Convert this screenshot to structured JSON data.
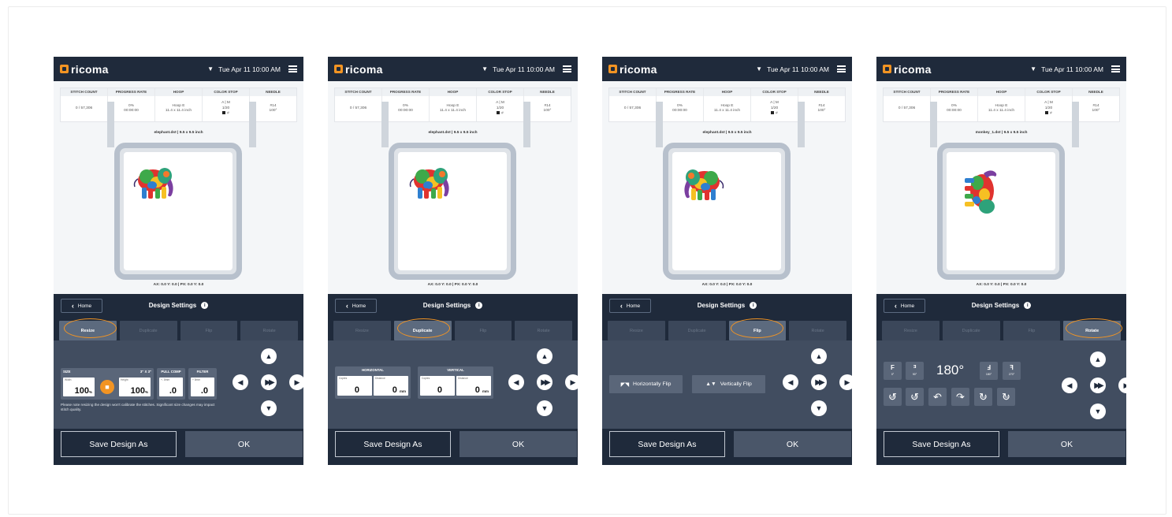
{
  "common": {
    "brand": "ricoma",
    "datetime": "Tue Apr 11  10:00 AM",
    "stat_headers": [
      "STITCH COUNT",
      "PROGRESS RATE",
      "HOOP",
      "COLOR STOP",
      "NEEDLE"
    ],
    "stitch_count": "0 / 57,306",
    "progress_pct": "0%",
    "progress_time": "00:00:00",
    "hoop_name": "Hoop E",
    "hoop_size": "11.4 x 11.4 inch",
    "color_mode": "A | M",
    "color_stop": "1/20",
    "color_num": "#",
    "needle_num": "#14",
    "needle_angle": "100°",
    "coords": "AX: 0.0  Y: 0.0  |  PX: 0.0  Y: 0.0",
    "home_label": "Home",
    "title": "Design Settings",
    "tabs": [
      "Resize",
      "Duplicate",
      "Flip",
      "Rotate"
    ],
    "save_label": "Save Design As",
    "ok_label": "OK"
  },
  "panels": [
    {
      "filename": "elephant.dst  |  9.5 x 9.5 inch",
      "active_tab": "Resize"
    },
    {
      "filename": "elephant.dst  |  9.5 x 9.5 inch",
      "active_tab": "Duplicate"
    },
    {
      "filename": "elephant.dst  |  9.5 x 9.5 inch",
      "active_tab": "Flip"
    },
    {
      "filename": "monkey_1.dst  |  9.5 x 9.5 inch",
      "active_tab": "Rotate"
    }
  ],
  "resize": {
    "size_label": "SIZE",
    "size_value": "3\" X 3\"",
    "width_label": "Width",
    "width_value": "100",
    "height_label": "Height",
    "height_value": "100",
    "unit": "%",
    "pull_comp_label": "PULL COMP",
    "pull_comp_sub": "+- 8mm",
    "pull_comp_value": ".0",
    "filter_label": "FILTER",
    "filter_sub": "+ 8mm",
    "filter_value": ".0",
    "note": "Please note resizing the design won't calibrate the stitches. Significant size changes may impact stitch quality."
  },
  "duplicate": {
    "horizontal_label": "HORIZONTAL",
    "vertical_label": "VERTICAL",
    "copies_label": "Copies",
    "distance_label": "Distance",
    "h_copies": "0",
    "h_distance": "0",
    "v_copies": "0",
    "v_distance": "0",
    "unit": "mm"
  },
  "flip": {
    "horizontal_label": "Horizontally Flip",
    "vertical_label": "Vertically Flip"
  },
  "rotate": {
    "angle": "180°",
    "presets": [
      {
        "glyph": "F",
        "label": "0°"
      },
      {
        "glyph": "ᴲ",
        "label": "90°"
      },
      {
        "glyph": "Ⅎ",
        "label": "180°"
      },
      {
        "glyph": "ꟻ",
        "label": "270°"
      }
    ],
    "steps": [
      "-45°",
      "-10°",
      "-1°",
      "+1°",
      "+10°",
      "+45°"
    ]
  },
  "colors": {
    "navy": "#1f2a3b",
    "accent": "#f29423",
    "panel": "#414d60"
  }
}
